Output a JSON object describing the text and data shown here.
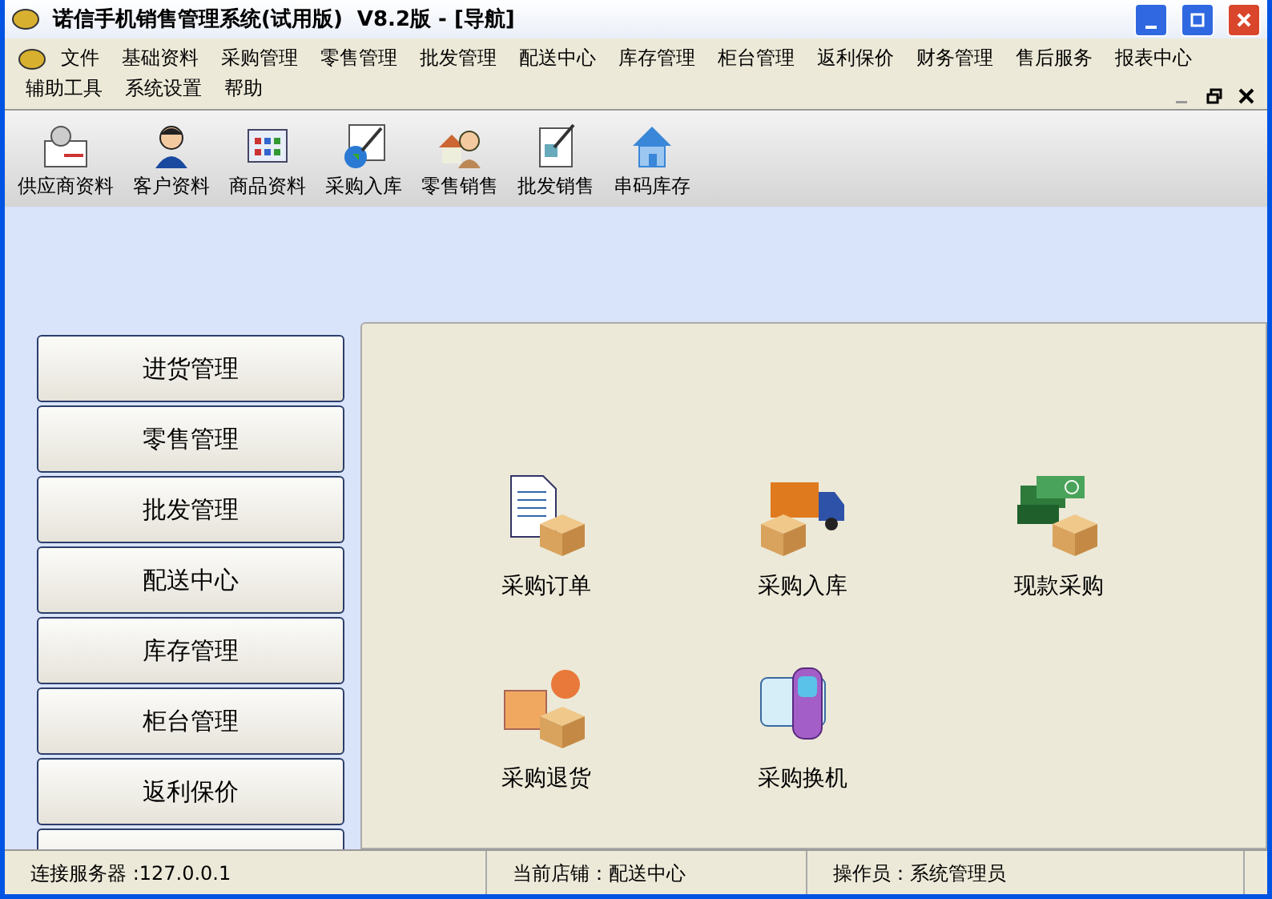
{
  "window": {
    "title": "诺信手机销售管理系统(试用版)  V8.2版 - [导航]"
  },
  "menu": {
    "items": [
      "文件",
      "基础资料",
      "采购管理",
      "零售管理",
      "批发管理",
      "配送中心",
      "库存管理",
      "柜台管理",
      "返利保价",
      "财务管理",
      "售后服务",
      "报表中心",
      "辅助工具",
      "系统设置",
      "帮助"
    ]
  },
  "toolbar": [
    {
      "label": "供应商资料",
      "kind": "supplier"
    },
    {
      "label": "客户资料",
      "kind": "customer"
    },
    {
      "label": "商品资料",
      "kind": "goods"
    },
    {
      "label": "采购入库",
      "kind": "purchase"
    },
    {
      "label": "零售销售",
      "kind": "retail"
    },
    {
      "label": "批发销售",
      "kind": "wholesale"
    },
    {
      "label": "串码库存",
      "kind": "house"
    }
  ],
  "sidebar": {
    "items": [
      {
        "label": "进货管理"
      },
      {
        "label": "零售管理"
      },
      {
        "label": "批发管理"
      },
      {
        "label": "配送中心"
      },
      {
        "label": "库存管理"
      },
      {
        "label": "柜台管理"
      },
      {
        "label": "返利保价"
      },
      {
        "kind": "cut"
      }
    ]
  },
  "panel": {
    "items": [
      {
        "label": "采购订单",
        "kind": "order"
      },
      {
        "label": "采购入库",
        "kind": "truck"
      },
      {
        "label": "现款采购",
        "kind": "cash"
      },
      {
        "label": "采购退货",
        "kind": "return"
      },
      {
        "label": "采购换机",
        "kind": "phone"
      }
    ]
  },
  "status_bar": {
    "server": "连接服务器 :127.0.0.1",
    "store": "当前店铺：配送中心",
    "operator": "操作员：系统管理员"
  }
}
